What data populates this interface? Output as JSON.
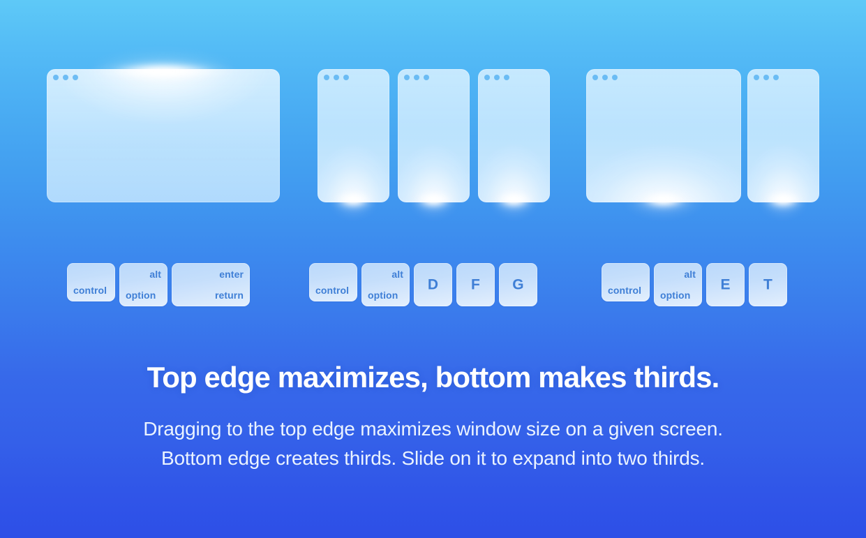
{
  "background": {
    "gradient_top": "#5ec9f7",
    "gradient_bottom": "#2d4fe7"
  },
  "accents": {
    "key_text": "#3f7fd6",
    "traffic_dot": "#5ab4f2",
    "headline_text": "#ffffff",
    "body_text": "#eaf3ff"
  },
  "demos": [
    {
      "name": "maximize",
      "glow_edge": "top",
      "windows": [
        {
          "label": "maximized-window",
          "width_pct": 100
        }
      ],
      "shortcut": [
        {
          "type": "modifier",
          "top": "",
          "bottom": "control",
          "align": "bottom-left"
        },
        {
          "type": "modifier",
          "top": "alt",
          "bottom": "option",
          "align": "split"
        },
        {
          "type": "modifier",
          "top": "enter",
          "bottom": "return",
          "align": "split-right"
        }
      ]
    },
    {
      "name": "thirds",
      "glow_edge": "bottom",
      "windows": [
        {
          "label": "left-third-window",
          "width_pct": 31
        },
        {
          "label": "center-third-window",
          "width_pct": 31
        },
        {
          "label": "right-third-window",
          "width_pct": 31
        }
      ],
      "shortcut": [
        {
          "type": "modifier",
          "top": "",
          "bottom": "control",
          "align": "bottom-left"
        },
        {
          "type": "modifier",
          "top": "alt",
          "bottom": "option",
          "align": "split"
        },
        {
          "type": "letter",
          "key": "D"
        },
        {
          "type": "letter",
          "key": "F"
        },
        {
          "type": "letter",
          "key": "G"
        }
      ]
    },
    {
      "name": "two-thirds",
      "glow_edge": "bottom",
      "windows": [
        {
          "label": "two-thirds-window",
          "width_pct": 65
        },
        {
          "label": "one-third-window",
          "width_pct": 31
        }
      ],
      "shortcut": [
        {
          "type": "modifier",
          "top": "",
          "bottom": "control",
          "align": "bottom-left"
        },
        {
          "type": "modifier",
          "top": "alt",
          "bottom": "option",
          "align": "split"
        },
        {
          "type": "letter",
          "key": "E"
        },
        {
          "type": "letter",
          "key": "T"
        }
      ]
    }
  ],
  "keys": {
    "control": "control",
    "alt": "alt",
    "option": "option",
    "enter": "enter",
    "return": "return",
    "d": "D",
    "f": "F",
    "g": "G",
    "e": "E",
    "t": "T"
  },
  "caption": {
    "headline": "Top edge maximizes, bottom makes thirds.",
    "body_line_1": "Dragging to the top edge maximizes window size on a given screen.",
    "body_line_2": "Bottom edge creates thirds. Slide on it to expand into two thirds."
  }
}
